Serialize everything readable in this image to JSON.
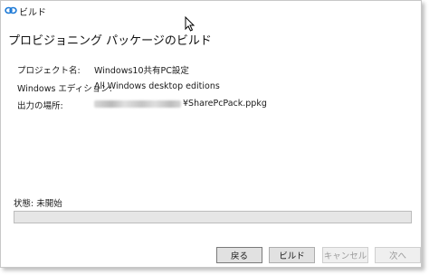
{
  "window": {
    "title": "ビルド",
    "icon": "infinity-link-icon"
  },
  "page": {
    "heading": "プロビジョニング パッケージのビルド"
  },
  "fields": [
    {
      "label": "プロジェクト名:",
      "value": "Windows10共有PC設定"
    },
    {
      "label": "Windows エディション:",
      "value": "All Windows desktop editions"
    },
    {
      "label": "出力の場所:",
      "value": "¥SharePcPack.ppkg"
    }
  ],
  "status": {
    "label": "状態:",
    "value": "未開始",
    "progress": 0
  },
  "buttons": {
    "back": "戻る",
    "build": "ビルド",
    "cancel": "キャンセル",
    "next": "次へ"
  },
  "colors": {
    "accent": "#06b025",
    "icon": "#1e7ad6"
  }
}
